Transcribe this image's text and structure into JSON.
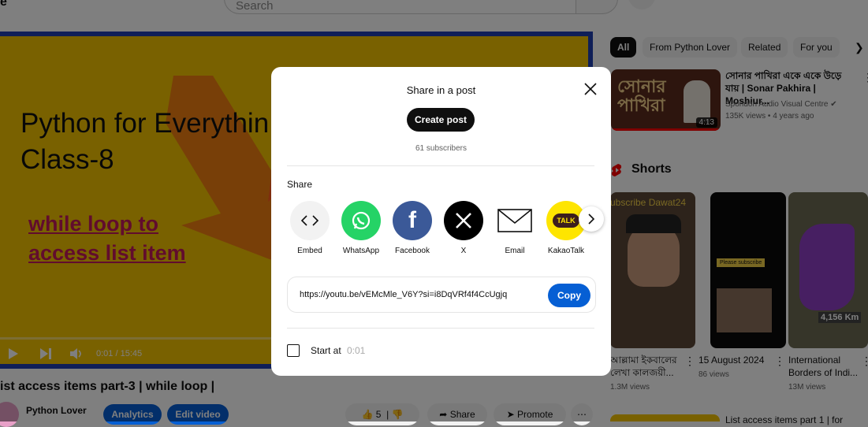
{
  "header": {
    "logo_fragment": "e",
    "search_placeholder": "Search"
  },
  "player": {
    "slide_title_line1": "Python for Everythin",
    "slide_title_line2": "Class-8",
    "slide_sub_line1": "while loop to",
    "slide_sub_line2": "access  list item",
    "time": "0:01 / 15:45"
  },
  "video": {
    "title": "ist access items part-3 | while loop |",
    "channel": "Python Lover",
    "analytics_label": "Analytics",
    "edit_label": "Edit video",
    "likes": "5",
    "share_label": "Share",
    "promote_label": "Promote"
  },
  "chips": [
    "All",
    "From Python Lover",
    "Related",
    "For you"
  ],
  "related": {
    "title": "সোনার পাখিরা একে একে উড়ে যায় | Sonar Pakhira | Moshiur...",
    "channel": "Spondon Audio Visual Centre",
    "meta": "135K views • 4 years ago",
    "duration": "4:13",
    "thumb_text": "সোনার পাখিরা"
  },
  "shorts": {
    "heading": "Shorts",
    "items": [
      {
        "title": "আল্লামা ইকবালের লেখা কালজয়ী...",
        "views": "1.3M views",
        "overlay": "ubscribe Dawat24"
      },
      {
        "title": "15 August 2024",
        "views": "86 views",
        "overlay": "Please subscribe"
      },
      {
        "title": "International Borders of Indi...",
        "views": "13M views",
        "overlay": "4,156 Km"
      }
    ]
  },
  "bottom_related": {
    "title": "List access items part 1 | for"
  },
  "modal": {
    "heading": "Share in a post",
    "create_post": "Create post",
    "subscribers": "61 subscribers",
    "share_heading": "Share",
    "options": [
      {
        "label": "Embed",
        "icon": "embed-icon"
      },
      {
        "label": "WhatsApp",
        "icon": "whatsapp-icon"
      },
      {
        "label": "Facebook",
        "icon": "facebook-icon"
      },
      {
        "label": "X",
        "icon": "x-icon"
      },
      {
        "label": "Email",
        "icon": "email-icon"
      },
      {
        "label": "KakaoTalk",
        "icon": "kakaotalk-icon"
      }
    ],
    "url": "https://youtu.be/vEMcMle_V6Y?si=i8DqVRf4f4CcUgjq",
    "copy_label": "Copy",
    "start_at_label": "Start at",
    "start_at_time": "0:01"
  },
  "colors": {
    "accent": "#065fd4",
    "whatsapp": "#25d366",
    "facebook": "#3b5998",
    "kakao": "#fee500"
  }
}
